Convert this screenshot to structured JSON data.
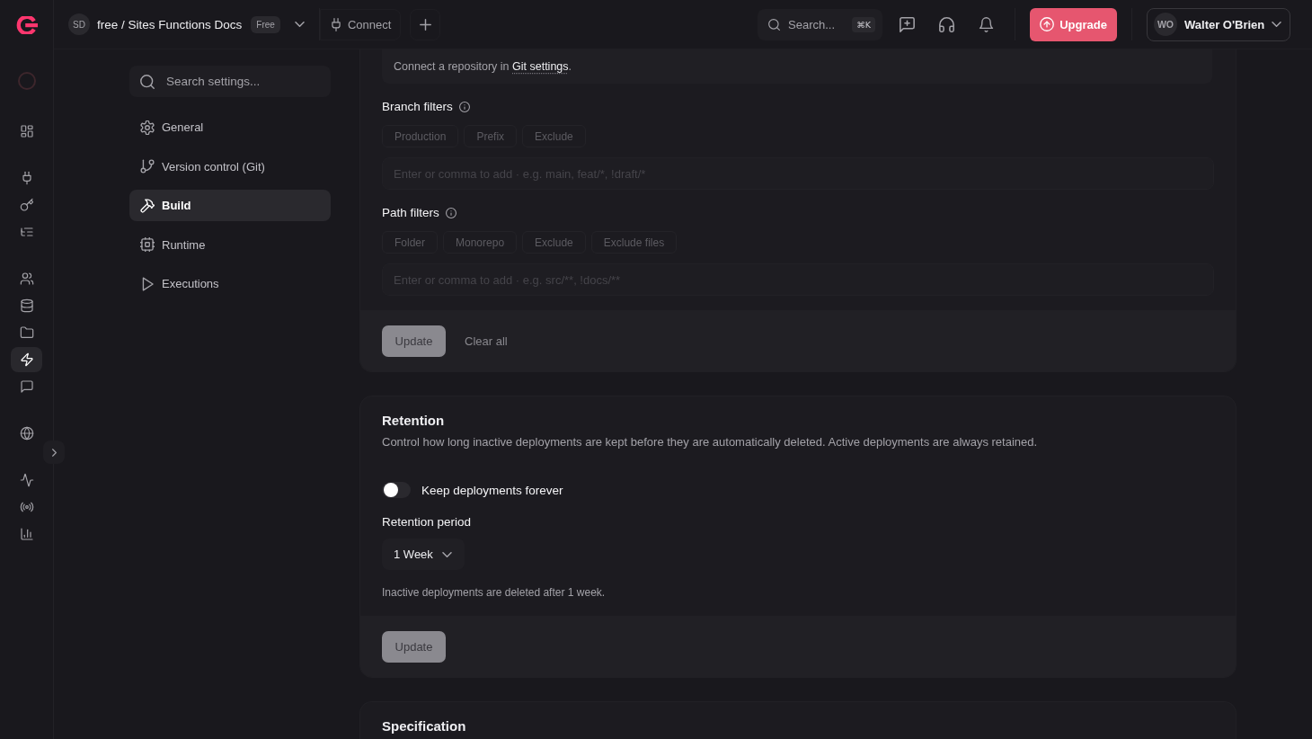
{
  "topbar": {
    "project": {
      "avatar": "SD",
      "name": "free / Sites Functions Docs",
      "plan": "Free"
    },
    "connect_button": "Connect",
    "search": {
      "placeholder": "Search...",
      "shortcut": "⌘K"
    },
    "upgrade_button": "Upgrade",
    "user": {
      "avatar": "WO",
      "name": "Walter O'Brien"
    }
  },
  "rail": {
    "groups": [
      {
        "items": [
          {
            "selected": false
          }
        ]
      },
      {
        "items": [
          {
            "selected": false
          },
          {
            "selected": false
          },
          {
            "selected": false
          }
        ]
      },
      {
        "items": [
          {
            "selected": false
          },
          {
            "selected": false
          },
          {
            "selected": false
          },
          {
            "selected": true
          },
          {
            "selected": false
          }
        ]
      },
      {
        "items": [
          {
            "selected": false
          }
        ]
      },
      {
        "items": [
          {
            "selected": false
          },
          {
            "selected": false
          },
          {
            "selected": false
          }
        ]
      }
    ]
  },
  "settings_nav": {
    "search": {
      "placeholder": "Search settings..."
    },
    "items": [
      {
        "label": "General",
        "selected": false
      },
      {
        "label": "Version control (Git)",
        "selected": false
      },
      {
        "label": "Build",
        "selected": true
      },
      {
        "label": "Runtime",
        "selected": false
      },
      {
        "label": "Executions",
        "selected": false
      }
    ]
  },
  "build_filters": {
    "notice": {
      "text": "Connect a repository in ",
      "link": "Git settings",
      "end": "."
    },
    "filters": [
      {
        "label": "Branch filters",
        "presets": [
          {
            "label": "Production",
            "disabled": true
          },
          {
            "label": "Prefix",
            "disabled": true
          },
          {
            "label": "Exclude",
            "disabled": true
          }
        ],
        "input": {
          "placeholder": "Enter or comma to add · e.g. main, feat/*, !draft/*",
          "disabled": true
        }
      },
      {
        "label": "Path filters",
        "presets": [
          {
            "label": "Folder",
            "disabled": true
          },
          {
            "label": "Monorepo",
            "disabled": true
          },
          {
            "label": "Exclude",
            "disabled": true
          },
          {
            "label": "Exclude files",
            "disabled": true
          }
        ],
        "input": {
          "placeholder": "Enter or comma to add · e.g. src/**, !docs/**",
          "disabled": true
        }
      }
    ],
    "update_button": {
      "label": "Update",
      "disabled": true
    },
    "clear_button": "Clear all"
  },
  "retention": {
    "title": "Retention",
    "description": "Control how long inactive deployments are kept before they are automatically deleted. Active deployments are always retained.",
    "toggle": {
      "label": "Keep deployments forever",
      "on": false
    },
    "period": {
      "label": "Retention period",
      "value": "1 Week"
    },
    "hint": "Inactive deployments are deleted after 1 week.",
    "update_button": {
      "label": "Update",
      "disabled": true
    }
  },
  "specification": {
    "title": "Specification"
  }
}
